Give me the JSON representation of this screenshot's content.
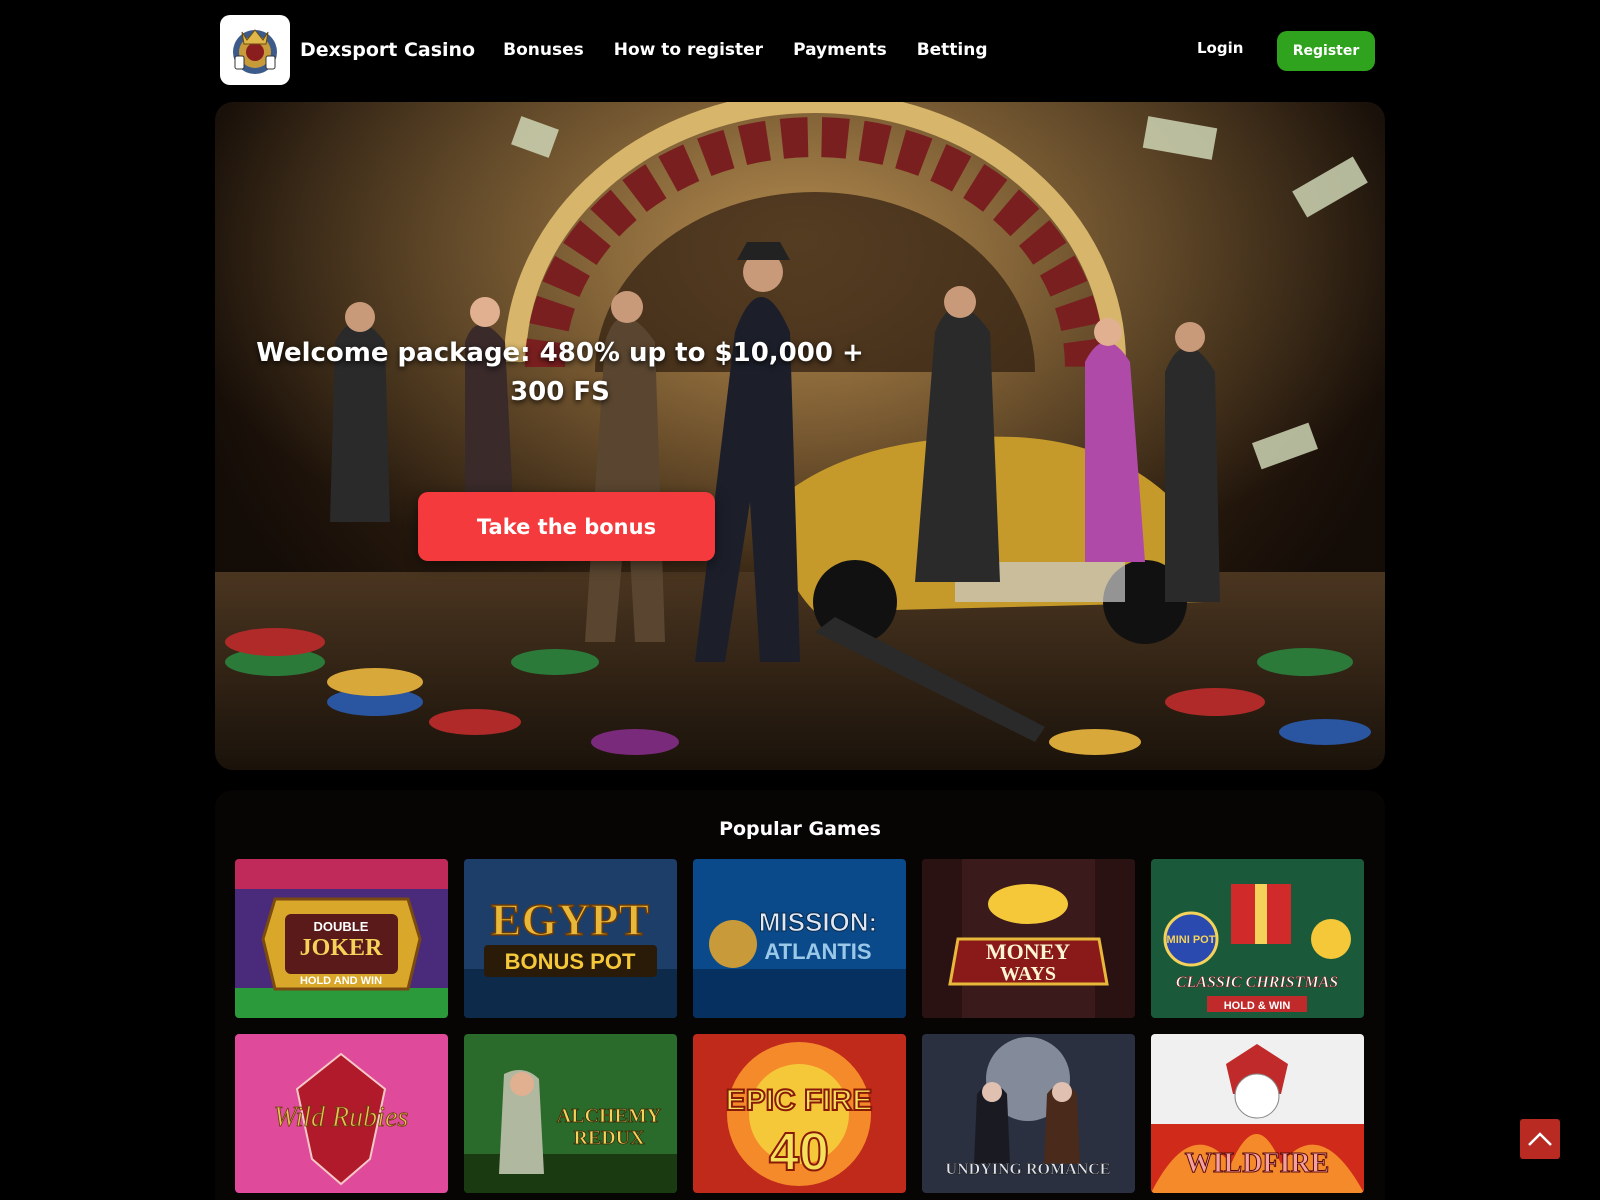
{
  "header": {
    "brand": "Dexsport Casino",
    "nav": [
      "Bonuses",
      "How to register",
      "Payments",
      "Betting"
    ],
    "login_label": "Login",
    "register_label": "Register"
  },
  "hero": {
    "title": "Welcome package: 480% up to $10,000 + 300 FS",
    "cta_label": "Take the bonus"
  },
  "games": {
    "title": "Popular Games",
    "tiles": [
      {
        "name": "Double Joker Hold and Win",
        "lines": [
          "DOUBLE",
          "JOKER",
          "HOLD AND WIN"
        ]
      },
      {
        "name": "Egypt Bonus Pot",
        "lines": [
          "EGYPT",
          "BONUS POT"
        ]
      },
      {
        "name": "Mission: Atlantis",
        "lines": [
          "MISSION:",
          "ATLANTIS"
        ]
      },
      {
        "name": "Money Ways",
        "lines": [
          "MONEY",
          "WAYS"
        ]
      },
      {
        "name": "Classic Christmas Hold & Win",
        "lines": [
          "MINI POT",
          "CLASSIC CHRISTMAS",
          "HOLD & WIN"
        ]
      },
      {
        "name": "Wild Rubies",
        "lines": [
          "Wild Rubies"
        ]
      },
      {
        "name": "Alchemy Redux",
        "lines": [
          "ALCHEMY",
          "REDUX"
        ]
      },
      {
        "name": "Epic Fire 40",
        "lines": [
          "EPIC FIRE",
          "40"
        ]
      },
      {
        "name": "Undying Romance",
        "lines": [
          "UNDYING ROMANCE"
        ]
      },
      {
        "name": "Wildfire",
        "lines": [
          "WILDFIRE"
        ]
      }
    ]
  },
  "colors": {
    "register_green": "#2fa31d",
    "cta_red": "#f43a3c",
    "scroll_top_red": "#b82a22"
  },
  "icons": {
    "logo": "casino-emblem-icon",
    "scroll_top": "chevron-up-icon"
  }
}
